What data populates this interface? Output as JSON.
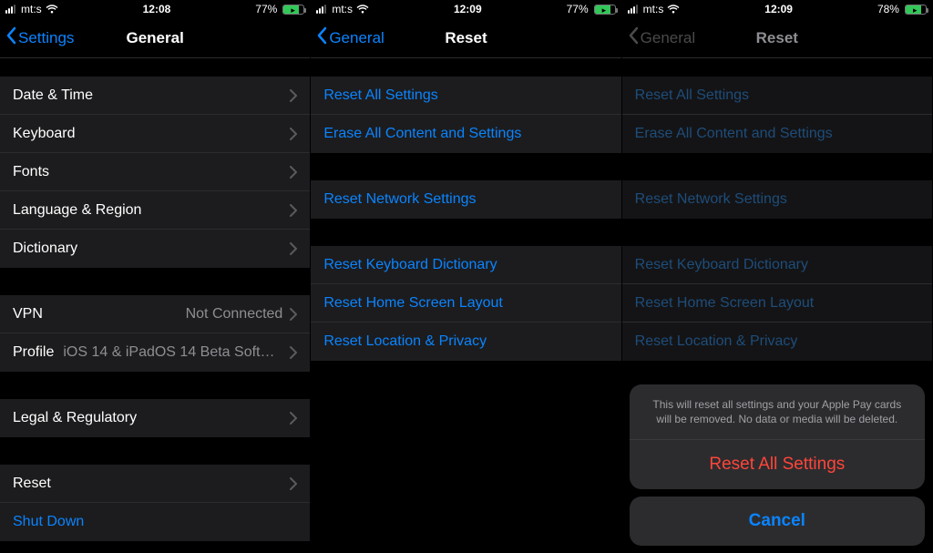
{
  "screens": [
    {
      "status": {
        "carrier": "mt:s",
        "time": "12:08",
        "battery_pct": "77%",
        "battery_fill": 77
      },
      "nav": {
        "back": "Settings",
        "title": "General"
      },
      "groups": [
        {
          "rows": [
            {
              "label": "Date & Time",
              "chevron": true
            },
            {
              "label": "Keyboard",
              "chevron": true
            },
            {
              "label": "Fonts",
              "chevron": true
            },
            {
              "label": "Language & Region",
              "chevron": true
            },
            {
              "label": "Dictionary",
              "chevron": true
            }
          ]
        },
        {
          "rows": [
            {
              "label": "VPN",
              "detail": "Not Connected",
              "chevron": true
            },
            {
              "label": "Profile",
              "detail": "iOS 14 & iPadOS 14 Beta Softwar...",
              "chevron": true
            }
          ]
        },
        {
          "rows": [
            {
              "label": "Legal & Regulatory",
              "chevron": true
            }
          ]
        },
        {
          "rows": [
            {
              "label": "Reset",
              "chevron": true
            },
            {
              "label": "Shut Down",
              "blue": true
            }
          ]
        }
      ]
    },
    {
      "status": {
        "carrier": "mt:s",
        "time": "12:09",
        "battery_pct": "77%",
        "battery_fill": 77
      },
      "nav": {
        "back": "General",
        "title": "Reset"
      },
      "groups": [
        {
          "rows": [
            {
              "label": "Reset All Settings",
              "blue": true
            },
            {
              "label": "Erase All Content and Settings",
              "blue": true
            }
          ]
        },
        {
          "rows": [
            {
              "label": "Reset Network Settings",
              "blue": true
            }
          ]
        },
        {
          "rows": [
            {
              "label": "Reset Keyboard Dictionary",
              "blue": true
            },
            {
              "label": "Reset Home Screen Layout",
              "blue": true
            },
            {
              "label": "Reset Location & Privacy",
              "blue": true
            }
          ]
        }
      ]
    },
    {
      "status": {
        "carrier": "mt:s",
        "time": "12:09",
        "battery_pct": "78%",
        "battery_fill": 78
      },
      "nav": {
        "back": "General",
        "title": "Reset",
        "dim": true
      },
      "dim": true,
      "groups": [
        {
          "rows": [
            {
              "label": "Reset All Settings",
              "dimblue": true
            },
            {
              "label": "Erase All Content and Settings",
              "dimblue": true
            }
          ]
        },
        {
          "rows": [
            {
              "label": "Reset Network Settings",
              "dimblue": true
            }
          ]
        },
        {
          "rows": [
            {
              "label": "Reset Keyboard Dictionary",
              "dimblue": true
            },
            {
              "label": "Reset Home Screen Layout",
              "dimblue": true
            },
            {
              "label": "Reset Location & Privacy",
              "dimblue": true
            }
          ]
        }
      ],
      "sheet": {
        "message": "This will reset all settings and your Apple Pay cards will be removed. No data or media will be deleted.",
        "action": "Reset All Settings",
        "cancel": "Cancel"
      }
    }
  ]
}
